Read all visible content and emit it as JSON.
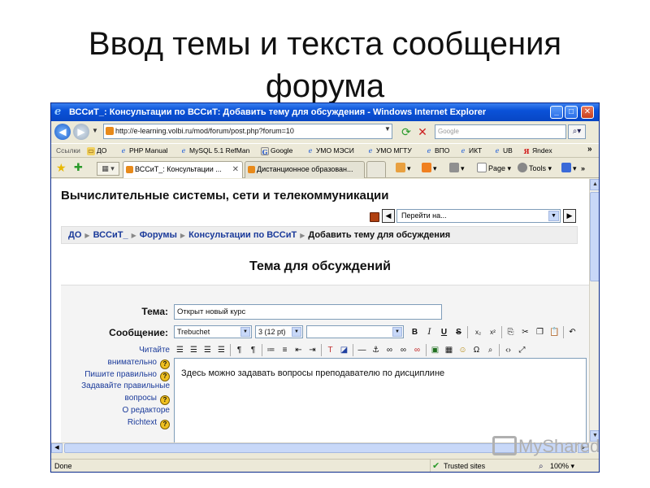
{
  "slide": {
    "title_line1": "Ввод темы и текста сообщения",
    "title_line2": "форума"
  },
  "window": {
    "title": "ВССиТ_: Консультации по ВССиТ: Добавить тему для обсуждения - Windows Internet Explorer",
    "controls": {
      "minimize": "_",
      "maximize": "□",
      "close": "✕"
    }
  },
  "address_bar": {
    "url": "http://e-learning.volbi.ru/mod/forum/post.php?forum=10",
    "search_placeholder": "Google"
  },
  "links_bar": {
    "label": "Ссылки",
    "items": [
      "ДО",
      "PHP Manual",
      "MySQL 5.1 RefMan",
      "Google",
      "УМО МЭСИ",
      "УМО МГТУ",
      "ВПО",
      "ИКТ",
      "UB",
      "Яndex"
    ],
    "more": "»"
  },
  "tabs": [
    {
      "label": "ВССиТ_: Консультации ..."
    },
    {
      "label": "Дистанционное образован..."
    }
  ],
  "command_bar": {
    "page": "Page",
    "tools": "Tools",
    "more": "»"
  },
  "page": {
    "site_title": "Вычислительные системы, сети и телекоммуникации",
    "jump_to": "Перейти на...",
    "breadcrumb": [
      "ДО",
      "ВССиТ_",
      "Форумы",
      "Консультации по ВССиТ"
    ],
    "breadcrumb_current": "Добавить тему для обсуждения",
    "form_heading": "Тема для обсуждений",
    "subject_label": "Тема:",
    "subject_value": "Открыт новый курс",
    "message_label": "Сообщение:",
    "editor": {
      "font": "Trebuchet",
      "size": "3 (12 pt)",
      "style": "",
      "bold": "B",
      "italic": "I",
      "underline": "U",
      "strike": "S",
      "sub": "x₂",
      "sup": "x²",
      "content": "Здесь можно задавать вопросы преподавателю по дисциплине"
    },
    "help_links": [
      "Читайте",
      "внимательно",
      "Пишите правильно",
      "Задавайте правильные",
      "вопросы",
      "О редакторе",
      "Richtext"
    ]
  },
  "status_bar": {
    "text": "Done",
    "zone": "Trusted sites",
    "zoom": "100%"
  },
  "watermark": "MyShared",
  "colors": {
    "titlebar": "#0a52d8",
    "link": "#1a3a9a",
    "chrome": "#ece9d8"
  }
}
